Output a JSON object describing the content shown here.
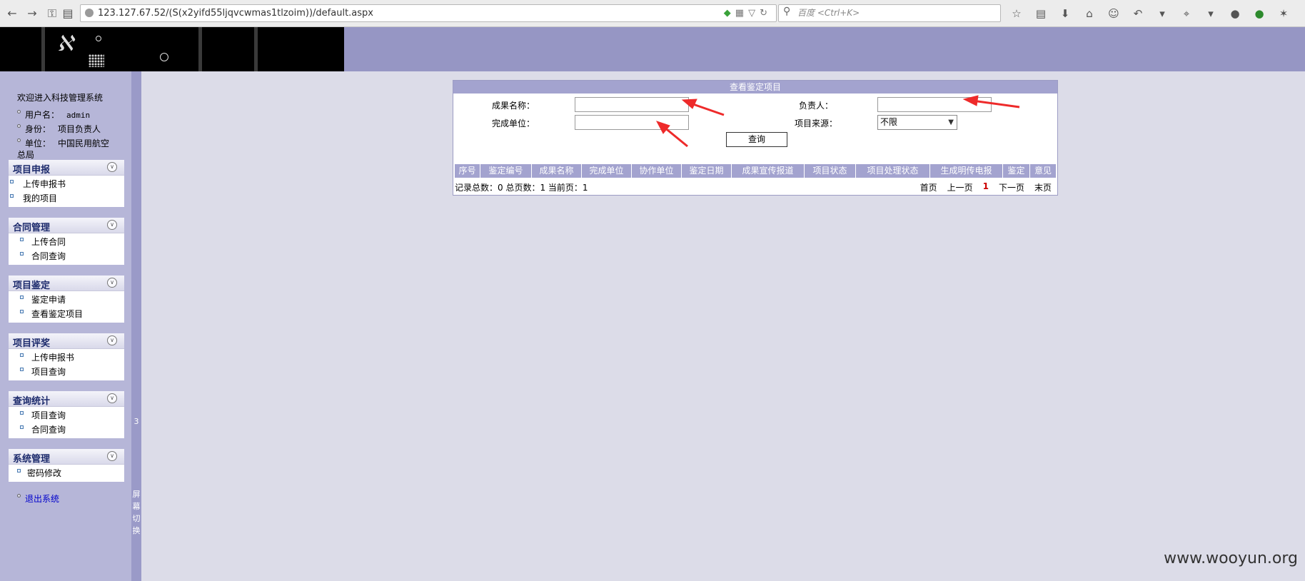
{
  "browser": {
    "url": "123.127.67.52/(S(x2yifd55ljqvcwmas1tlzoim))/default.aspx",
    "search_placeholder": "百度 <Ctrl+K>"
  },
  "sidebar": {
    "welcome": "欢迎进入科技管理系统",
    "user_label": "用户名：",
    "user_value": "admin",
    "role_label": "身份：",
    "role_value": "项目负责人",
    "unit_label": "单位：",
    "unit_value": "中国民用航空",
    "unit_value_cont": "总局",
    "panels": [
      {
        "title": "项目申报",
        "items": [
          "上传申报书",
          "我的项目"
        ]
      },
      {
        "title": "合同管理",
        "items": [
          "上传合同",
          "合同查询"
        ]
      },
      {
        "title": "项目鉴定",
        "items": [
          "鉴定申请",
          "查看鉴定项目"
        ]
      },
      {
        "title": "项目评奖",
        "items": [
          "上传申报书",
          "项目查询"
        ]
      },
      {
        "title": "查询统计",
        "items": [
          "项目查询",
          "合同查询"
        ]
      },
      {
        "title": "系统管理",
        "items": [
          "密码修改"
        ]
      }
    ],
    "logout": "退出系统",
    "divider_num": "3",
    "divider_text": [
      "屏",
      "幕",
      "切",
      "换"
    ]
  },
  "form": {
    "title": "查看鉴定项目",
    "name_label": "成果名称：",
    "person_label": "负责人：",
    "unit_label": "完成单位：",
    "source_label": "项目来源：",
    "source_value": "不限",
    "query_button": "查询"
  },
  "table": {
    "headers": [
      "序号",
      "鉴定编号",
      "成果名称",
      "完成单位",
      "协作单位",
      "鉴定日期",
      "成果宣传报道",
      "项目状态",
      "项目处理状态",
      "生成明传电报",
      "鉴定",
      "意见"
    ],
    "summary": "记录总数：0 总页数：1 当前页：1"
  },
  "pager": {
    "first": "首页",
    "prev": "上一页",
    "current": "1",
    "next": "下一页",
    "last": "末页"
  },
  "watermark": "www.wooyun.org",
  "colors": {
    "header_band": "#9696c4",
    "sidebar": "#b6b6d8",
    "table_header": "#a3a3cf",
    "arrow": "#ee2a2a"
  }
}
